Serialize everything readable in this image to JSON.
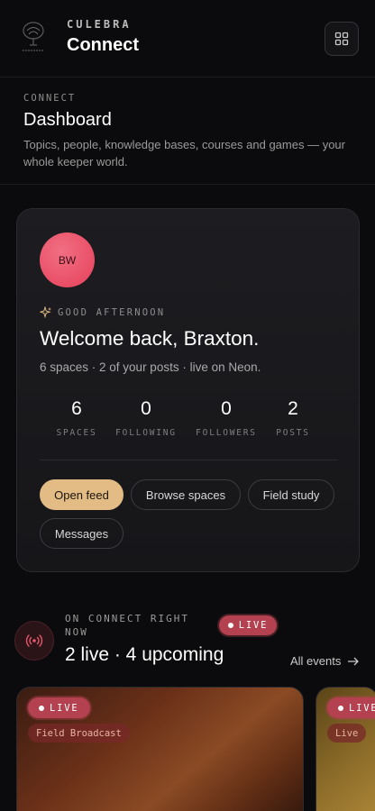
{
  "header": {
    "brand_small": "CULEBRA",
    "brand_big": "Connect",
    "menu_icon": "grid-icon"
  },
  "section": {
    "crumb": "CONNECT",
    "title": "Dashboard",
    "description": "Topics, people, knowledge bases, courses and games — your whole keeper world."
  },
  "welcome": {
    "avatar_initials": "BW",
    "greeting": "GOOD AFTERNOON",
    "title": "Welcome back, Braxton.",
    "subline": "6 spaces · 2 of your posts · live on Neon.",
    "stats": [
      {
        "value": "6",
        "label": "SPACES"
      },
      {
        "value": "0",
        "label": "FOLLOWING"
      },
      {
        "value": "0",
        "label": "FOLLOWERS"
      },
      {
        "value": "2",
        "label": "POSTS"
      }
    ],
    "buttons": {
      "open_feed": "Open feed",
      "browse_spaces": "Browse spaces",
      "field_study": "Field study",
      "messages": "Messages"
    }
  },
  "on_connect": {
    "kicker": "ON CONNECT RIGHT NOW",
    "live_chip": "LIVE",
    "count": "2 live · 4 upcoming",
    "all_events": "All events"
  },
  "events": [
    {
      "status": "LIVE",
      "tag": "Field Broadcast"
    },
    {
      "status": "LIVE",
      "tag": "Live"
    }
  ],
  "colors": {
    "accent": "#e2bb85",
    "live": "#b3414f",
    "avatar": "#e5405a",
    "background": "#0b0b0d"
  }
}
